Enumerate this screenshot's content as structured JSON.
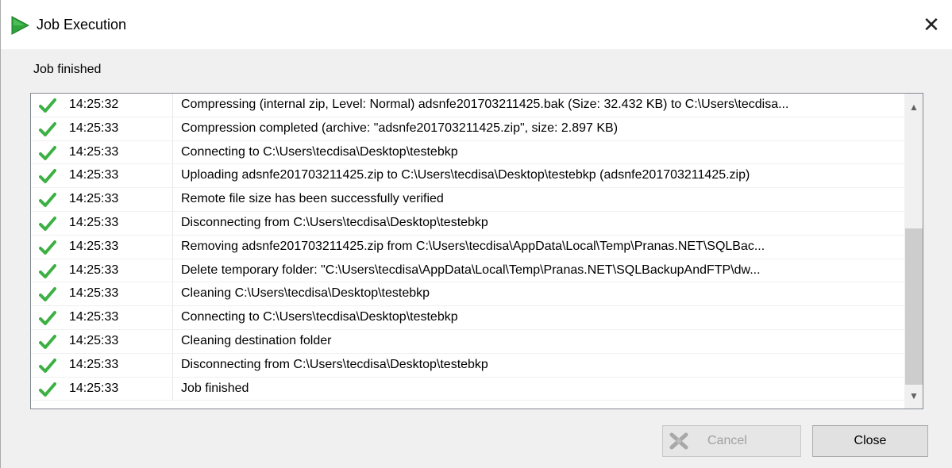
{
  "window": {
    "title": "Job Execution",
    "icon": "play-icon",
    "close_symbol": "✕"
  },
  "status": "Job finished",
  "log": [
    {
      "time": "14:25:32",
      "message": "Compressing (internal zip, Level: Normal) adsnfe201703211425.bak (Size: 32.432 KB) to C:\\Users\\tecdisa..."
    },
    {
      "time": "14:25:33",
      "message": "Compression completed (archive: \"adsnfe201703211425.zip\", size: 2.897 KB)"
    },
    {
      "time": "14:25:33",
      "message": "Connecting to C:\\Users\\tecdisa\\Desktop\\testebkp"
    },
    {
      "time": "14:25:33",
      "message": "Uploading adsnfe201703211425.zip to C:\\Users\\tecdisa\\Desktop\\testebkp (adsnfe201703211425.zip)"
    },
    {
      "time": "14:25:33",
      "message": "Remote file size has been successfully verified"
    },
    {
      "time": "14:25:33",
      "message": "Disconnecting from C:\\Users\\tecdisa\\Desktop\\testebkp"
    },
    {
      "time": "14:25:33",
      "message": "Removing adsnfe201703211425.zip from C:\\Users\\tecdisa\\AppData\\Local\\Temp\\Pranas.NET\\SQLBac..."
    },
    {
      "time": "14:25:33",
      "message": "Delete temporary folder: \"C:\\Users\\tecdisa\\AppData\\Local\\Temp\\Pranas.NET\\SQLBackupAndFTP\\dw..."
    },
    {
      "time": "14:25:33",
      "message": "Cleaning C:\\Users\\tecdisa\\Desktop\\testebkp"
    },
    {
      "time": "14:25:33",
      "message": "Connecting to C:\\Users\\tecdisa\\Desktop\\testebkp"
    },
    {
      "time": "14:25:33",
      "message": "Cleaning destination folder"
    },
    {
      "time": "14:25:33",
      "message": "Disconnecting from C:\\Users\\tecdisa\\Desktop\\testebkp"
    },
    {
      "time": "14:25:33",
      "message": "Job finished"
    }
  ],
  "buttons": {
    "cancel_label": "Cancel",
    "close_label": "Close"
  },
  "colors": {
    "check_green": "#3cb043",
    "play_green": "#2e9e3e"
  }
}
